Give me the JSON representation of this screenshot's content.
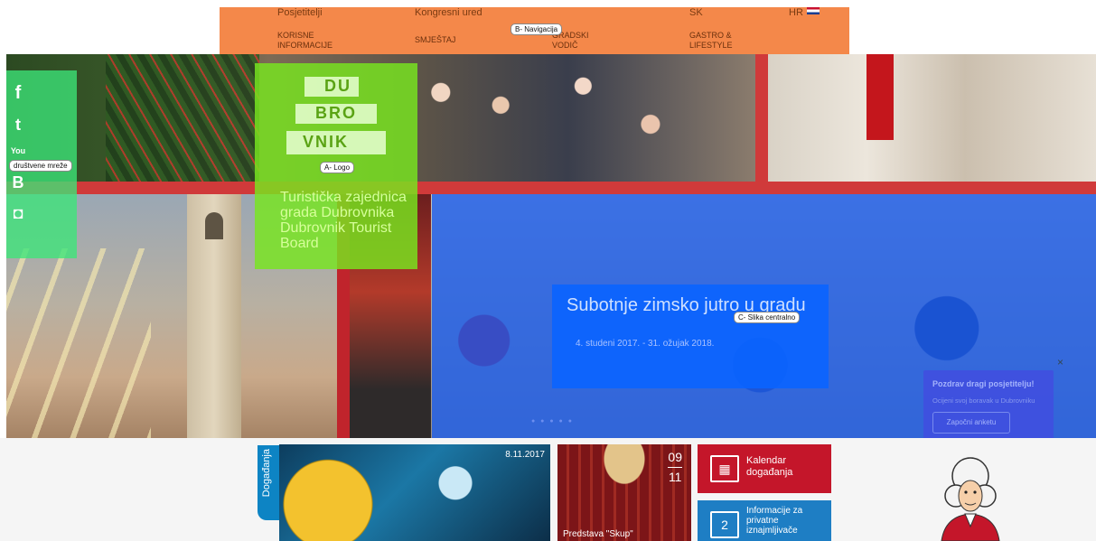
{
  "nav": {
    "top_links": [
      "Posjetitelji",
      "Kongresni ured"
    ],
    "search_placeholder": "SK",
    "lang": "HR",
    "main_links": [
      "KORISNE INFORMACIJE",
      "SMJEŠTAJ",
      "GRADSKI VODIČ",
      "GASTRO & LIFESTYLE"
    ],
    "overlay_label": "B- Navigacija"
  },
  "social": {
    "overlay_label": "društvene mreže",
    "icons": [
      "facebook-icon",
      "twitter-icon",
      "youtube-icon",
      "blogger-icon",
      "instagram-icon"
    ],
    "glyphs": [
      "f",
      "t",
      "You",
      "B",
      "◘"
    ]
  },
  "logo": {
    "overlay_label": "A- Logo",
    "mark_letters": [
      "DU",
      "BRO",
      "VNIK"
    ],
    "board_name": "Turistička zajednica grada Dubrovnika Dubrovnik Tourist Board"
  },
  "central_image": {
    "overlay_label": "C- Slika centralno",
    "event_title": "Subotnje zimsko jutro u gradu",
    "event_dates": "4. studeni 2017. - 31. ožujak 2018."
  },
  "greeting": {
    "title": "Pozdrav dragi posjetitelju!",
    "subtitle": "Ocijeni svoj boravak u Dubrovniku",
    "button": "Započni anketu",
    "close": "×"
  },
  "bottom": {
    "events_tab": "Događanja",
    "card1_date": "8.11.2017",
    "card2_day": "09",
    "card2_month": "11",
    "card2_caption": "Predstava \"Skup\"",
    "tile_calendar": "Kalendar događanja",
    "tile_rental": "Informacije za privatne iznajmljivače"
  },
  "colors": {
    "nav_overlay": "#f4884a",
    "social_overlay": "#3ce678",
    "logo_overlay": "#78e61e",
    "image_overlay": "#145af0",
    "brand_red": "#c4162a",
    "brand_blue": "#1e7ec4"
  }
}
